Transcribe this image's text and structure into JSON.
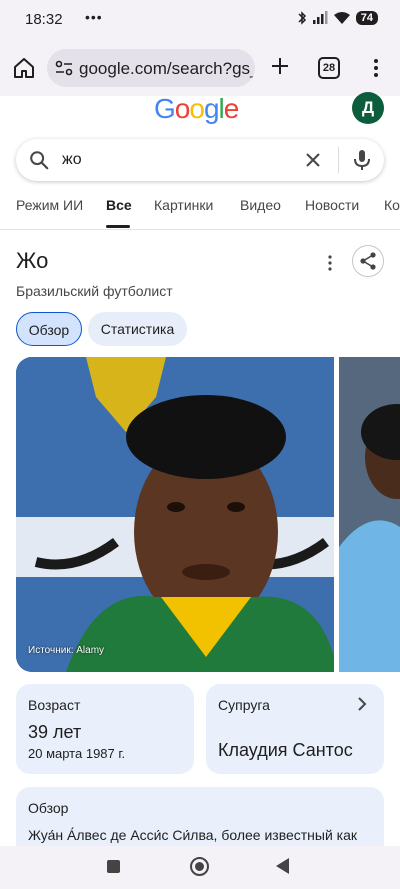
{
  "status_bar": {
    "time": "18:32",
    "extra": "•••",
    "battery": "74"
  },
  "browser": {
    "url": "google.com/search?gs_",
    "tab_count": "28"
  },
  "google": {
    "logo_letters": [
      "G",
      "o",
      "o",
      "g",
      "l",
      "e"
    ],
    "logo_colors": [
      "#4285f4",
      "#ea4335",
      "#fbbc05",
      "#4285f4",
      "#34a853",
      "#ea4335"
    ],
    "avatar_letter": "Д",
    "avatar_color": "#0b5d3b"
  },
  "search": {
    "query": "жо"
  },
  "tabs": [
    {
      "label": "Режим ИИ"
    },
    {
      "label": "Все",
      "active": true
    },
    {
      "label": "Картинки"
    },
    {
      "label": "Видео"
    },
    {
      "label": "Новости"
    },
    {
      "label": "Ко"
    }
  ],
  "knowledge_panel": {
    "title": "Жо",
    "subtitle": "Бразильский футболист",
    "chips": [
      "Обзор",
      "Статистика"
    ],
    "photo_caption": "Источник: Alamy",
    "age": {
      "label": "Возраст",
      "value": "39 лет",
      "sub": "20 марта 1987 г."
    },
    "spouse": {
      "label": "Супруга",
      "value": "Клаудия Сантос"
    },
    "overview": {
      "label": "Обзор",
      "text": "Жуа́н А́лвес де Асси́с Си́лва, более известный как"
    }
  }
}
